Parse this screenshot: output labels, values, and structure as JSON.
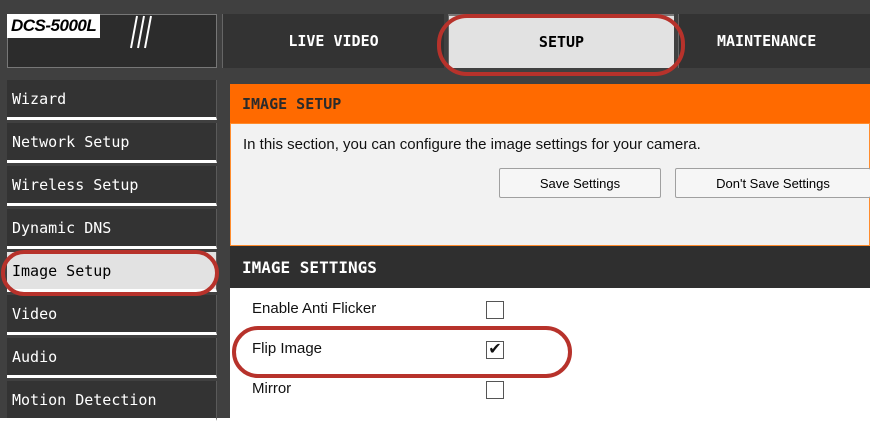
{
  "brand": {
    "model": "DCS-5000L"
  },
  "nav": {
    "tabs": [
      {
        "label": "LIVE VIDEO"
      },
      {
        "label": "SETUP"
      },
      {
        "label": "MAINTENANCE"
      }
    ]
  },
  "sidebar": {
    "items": [
      {
        "label": "Wizard"
      },
      {
        "label": "Network Setup"
      },
      {
        "label": "Wireless Setup"
      },
      {
        "label": "Dynamic DNS"
      },
      {
        "label": "Image Setup"
      },
      {
        "label": "Video"
      },
      {
        "label": "Audio"
      },
      {
        "label": "Motion Detection"
      }
    ]
  },
  "image_setup": {
    "title": "IMAGE SETUP",
    "description": "In this section, you can configure the image settings for your camera.",
    "save_label": "Save Settings",
    "dont_save_label": "Don't Save Settings"
  },
  "image_settings": {
    "title": "IMAGE SETTINGS",
    "rows": [
      {
        "label": "Enable Anti Flicker",
        "checked": false,
        "mark": ""
      },
      {
        "label": "Flip Image",
        "checked": true,
        "mark": "✔"
      },
      {
        "label": "Mirror",
        "checked": false,
        "mark": ""
      }
    ]
  },
  "colors": {
    "accent_orange": "#ff6a00",
    "highlight_red": "#b7322b",
    "dark_bg": "#404040"
  }
}
